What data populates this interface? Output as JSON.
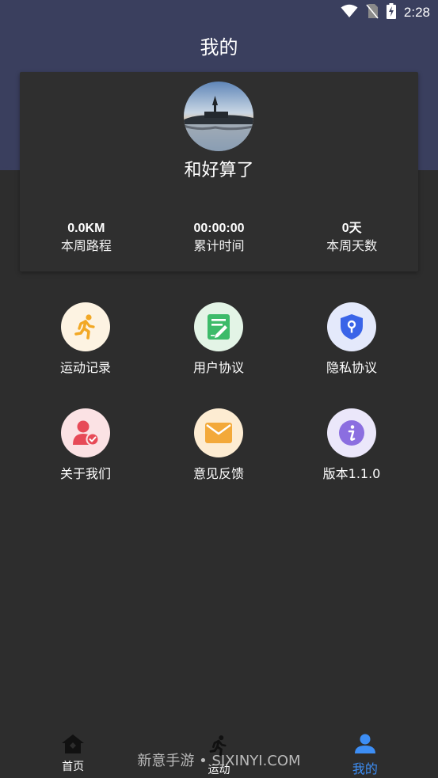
{
  "status_bar": {
    "time": "2:28",
    "icons": [
      "wifi-icon",
      "no-sim-icon",
      "battery-charging-icon"
    ]
  },
  "header": {
    "title": "我的"
  },
  "profile": {
    "username": "和好算了",
    "avatar": "lake-castle-photo",
    "stats": [
      {
        "value": "0.0KM",
        "label": "本周路程"
      },
      {
        "value": "00:00:00",
        "label": "累计时间"
      },
      {
        "value": "0天",
        "label": "本周天数"
      }
    ]
  },
  "menu": {
    "items": [
      {
        "label": "运动记录",
        "icon": "running-icon",
        "bg": "#fdf3e2",
        "color": "#f2a825"
      },
      {
        "label": "用户协议",
        "icon": "document-edit-icon",
        "bg": "#e3f4e6",
        "color": "#3dbb6a"
      },
      {
        "label": "隐私协议",
        "icon": "shield-lock-icon",
        "bg": "#e4e9fb",
        "color": "#3a64e8"
      },
      {
        "label": "关于我们",
        "icon": "user-check-icon",
        "bg": "#fbe2e4",
        "color": "#e74a57"
      },
      {
        "label": "意见反馈",
        "icon": "mail-icon",
        "bg": "#fdecd2",
        "color": "#f3a93a"
      },
      {
        "label": "版本1.1.0",
        "icon": "info-icon",
        "bg": "#ebe7fa",
        "color": "#8b6ee0"
      }
    ]
  },
  "bottom_nav": {
    "items": [
      {
        "label": "首页",
        "icon": "home-icon"
      },
      {
        "label": "运动",
        "icon": "run-icon"
      },
      {
        "label": "我的",
        "icon": "user-icon",
        "active": true
      }
    ],
    "active_color": "#3d8ef5"
  },
  "watermark": "新意手游 • SJXINYI.COM"
}
